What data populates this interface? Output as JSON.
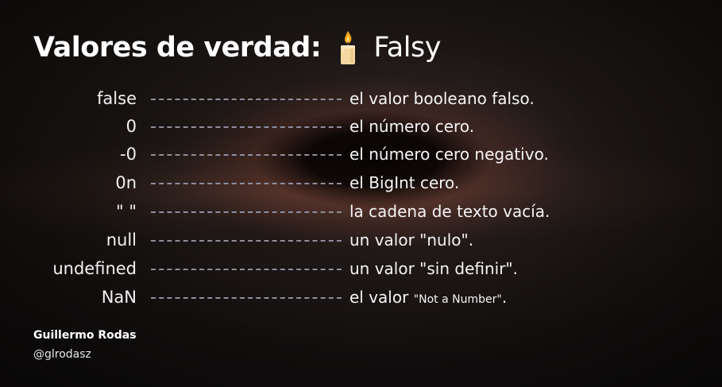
{
  "title": {
    "main": "Valores de verdad:",
    "icon": "candle-icon",
    "sub": "Falsy"
  },
  "rows": [
    {
      "value": "false",
      "desc": "el valor booleano falso."
    },
    {
      "value": "0",
      "desc": "el número cero."
    },
    {
      "value": "-0",
      "desc": "el número cero negativo."
    },
    {
      "value": "0n",
      "desc": "el BigInt cero."
    },
    {
      "value": "\" \"",
      "desc": "la cadena de texto vacía."
    },
    {
      "value": "null",
      "desc": "un valor \"nulo\"."
    },
    {
      "value": "undefined",
      "desc": "un valor \"sin definir\"."
    },
    {
      "value": "NaN",
      "desc": "el valor ",
      "desc_small": "\"Not a Number\"",
      "desc_end": "."
    }
  ],
  "author": {
    "name": "Guillermo Rodas",
    "handle": "@glrodasz"
  },
  "colors": {
    "dash": "#8e8e9c",
    "text": "#ffffff",
    "candle_flame": "#f4a51c",
    "candle_body": "#f6d9a0"
  }
}
